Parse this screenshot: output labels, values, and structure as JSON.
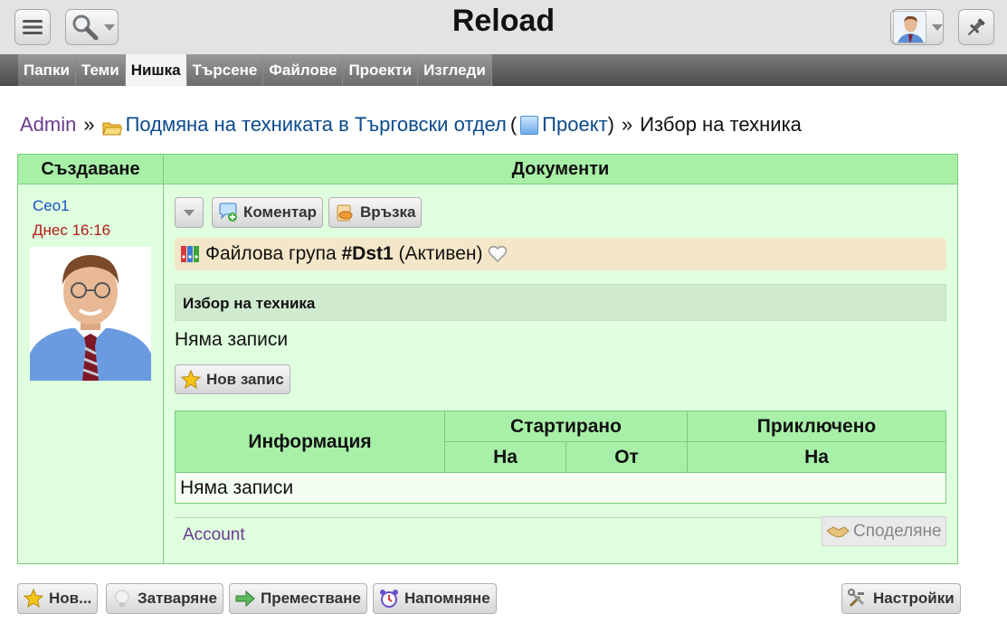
{
  "header": {
    "title": "Reload",
    "menu_icon": "hamburger-icon",
    "search_icon": "search-icon",
    "pin_icon": "pin-icon"
  },
  "tabs": [
    {
      "label": "Папки",
      "active": false
    },
    {
      "label": "Теми",
      "active": false
    },
    {
      "label": "Нишка",
      "active": true
    },
    {
      "label": "Търсене",
      "active": false
    },
    {
      "label": "Файлове",
      "active": false
    },
    {
      "label": "Проекти",
      "active": false
    },
    {
      "label": "Изгледи",
      "active": false
    }
  ],
  "breadcrumb": {
    "admin": "Admin",
    "sep1": "»",
    "folder": "Подмяна на техниката в Търговски отдел",
    "paren_open": "(",
    "project": "Проект",
    "paren_close": ")",
    "sep2": "»",
    "current": "Избор на техника"
  },
  "table": {
    "col_create": "Създаване",
    "col_docs": "Документи"
  },
  "post": {
    "author": "Ceo1",
    "date": "Днес 16:16"
  },
  "actions": {
    "comment": "Коментар",
    "link": "Връзка"
  },
  "filegroup": {
    "prefix": "Файлова група ",
    "id": "#Dst1",
    "status": " (Активен)"
  },
  "section": {
    "title": "Избор на техника",
    "no_entries": "Няма записи",
    "new_entry": "Нов запис"
  },
  "info_table": {
    "info": "Информация",
    "started": "Стартирано",
    "finished": "Приключено",
    "on1": "На",
    "from": "От",
    "on2": "На",
    "no_entries": "Няма записи"
  },
  "footer": {
    "account": "Account",
    "share": "Споделяне"
  },
  "bottom_buttons": {
    "new": "Нов...",
    "close": "Затваряне",
    "move": "Преместване",
    "remind": "Напомняне",
    "settings": "Настройки"
  }
}
